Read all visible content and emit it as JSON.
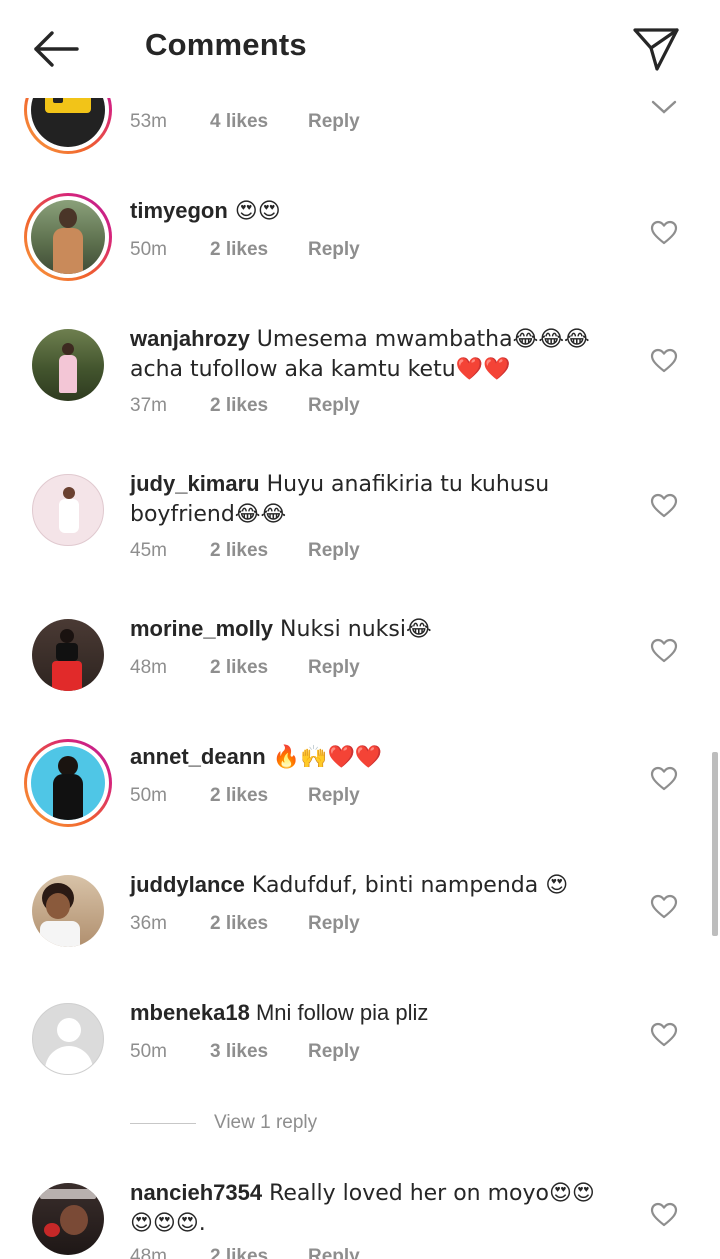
{
  "header": {
    "title": "Comments"
  },
  "comments": [
    {
      "user": "",
      "text": "",
      "time": "53m",
      "likes": "4 likes",
      "reply": "Reply"
    },
    {
      "user": "timyegon",
      "text": " 😍😍",
      "time": "50m",
      "likes": "2 likes",
      "reply": "Reply"
    },
    {
      "user": "wanjahrozy",
      "text": " Umesema mwambatha😂😂😂 acha tufollow aka kamtu ketu❤️❤️",
      "time": "37m",
      "likes": "2 likes",
      "reply": "Reply"
    },
    {
      "user": "judy_kimaru",
      "text": " Huyu anafikiria tu kuhusu boyfriend😂😂",
      "time": "45m",
      "likes": "2 likes",
      "reply": "Reply"
    },
    {
      "user": "morine_molly",
      "text": " Nuksi nuksi😂",
      "time": "48m",
      "likes": "2 likes",
      "reply": "Reply"
    },
    {
      "user": "annet_deann",
      "text": " 🔥🙌❤️❤️",
      "time": "50m",
      "likes": "2 likes",
      "reply": "Reply"
    },
    {
      "user": "juddylance",
      "text": " Kadufduf, binti nampenda 😍",
      "time": "36m",
      "likes": "2 likes",
      "reply": "Reply"
    },
    {
      "user": "mbeneka18",
      "text": " Mni follow pia pliz",
      "time": "50m",
      "likes": "3 likes",
      "reply": "Reply"
    },
    {
      "user": "nancieh7354",
      "text": " Really loved her on moyo😍😍 😍😍😍.",
      "time": "48m",
      "likes": "2 likes",
      "reply": "Reply"
    }
  ],
  "view_replies": "View 1 reply",
  "icons": {
    "back": "arrow-left-icon",
    "share": "paper-plane-icon",
    "like": "heart-outline-icon",
    "collapse": "chevron-down-icon"
  },
  "colors": {
    "text": "#262626",
    "meta": "#8e8e8e",
    "story_ring_start": "#f9a03f",
    "story_ring_end": "#b6209a"
  }
}
